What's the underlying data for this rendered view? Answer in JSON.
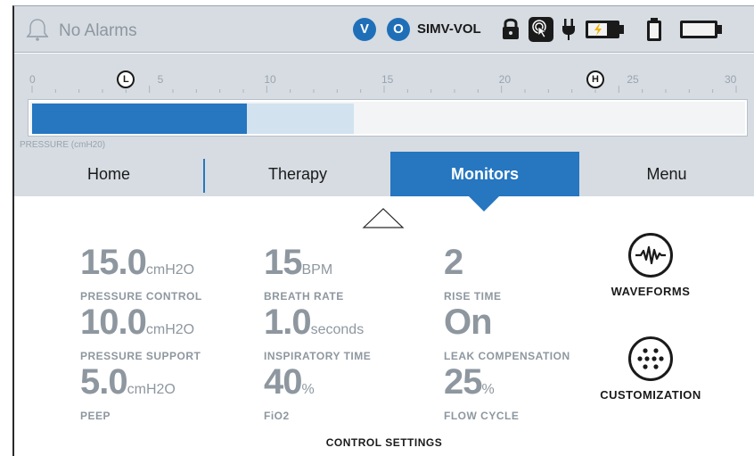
{
  "status": {
    "alarm_text": "No Alarms",
    "badge_v": "V",
    "badge_o": "O",
    "mode": "SIMV-VOL",
    "icons": [
      "bell-icon",
      "lock-icon",
      "touch-icon",
      "plug-icon",
      "battery-charging-icon",
      "battery-internal-icon",
      "battery-external-icon"
    ]
  },
  "gauge": {
    "scale_min": 0,
    "scale_max": 30,
    "tick_labels": [
      "0",
      "5",
      "10",
      "15",
      "20",
      "25",
      "30"
    ],
    "low_limit_label": "L",
    "low_limit_value": 4,
    "high_limit_label": "H",
    "high_limit_value": 24,
    "current_pressure": 9.0,
    "range_upper": 13.5,
    "label": "PRESSURE (cmH20)",
    "colors": {
      "fill": "#2676c0",
      "range": "#d3e2ef"
    }
  },
  "tabs": {
    "home": "Home",
    "therapy": "Therapy",
    "monitors": "Monitors",
    "menu": "Menu",
    "active": "Monitors"
  },
  "settings": {
    "pressure_control": {
      "value": "15.0",
      "unit": "cmH2O",
      "label": "PRESSURE CONTROL"
    },
    "breath_rate": {
      "value": "15",
      "unit": "BPM",
      "label": "BREATH RATE"
    },
    "rise_time": {
      "value": "2",
      "unit": "",
      "label": "RISE TIME"
    },
    "pressure_support": {
      "value": "10.0",
      "unit": "cmH2O",
      "label": "PRESSURE SUPPORT"
    },
    "inspiratory_time": {
      "value": "1.0",
      "unit": "seconds",
      "label": "INSPIRATORY TIME"
    },
    "leak_compensation": {
      "value": "On",
      "unit": "",
      "label": "LEAK COMPENSATION"
    },
    "peep": {
      "value": "5.0",
      "unit": "cmH2O",
      "label": "PEEP"
    },
    "fio2": {
      "value": "40",
      "unit": "%",
      "label": "FiO2"
    },
    "flow_cycle": {
      "value": "25",
      "unit": "%",
      "label": "FLOW CYCLE"
    }
  },
  "side_buttons": {
    "waveforms": "WAVEFORMS",
    "customization": "CUSTOMIZATION"
  },
  "section_label": "CONTROL SETTINGS"
}
